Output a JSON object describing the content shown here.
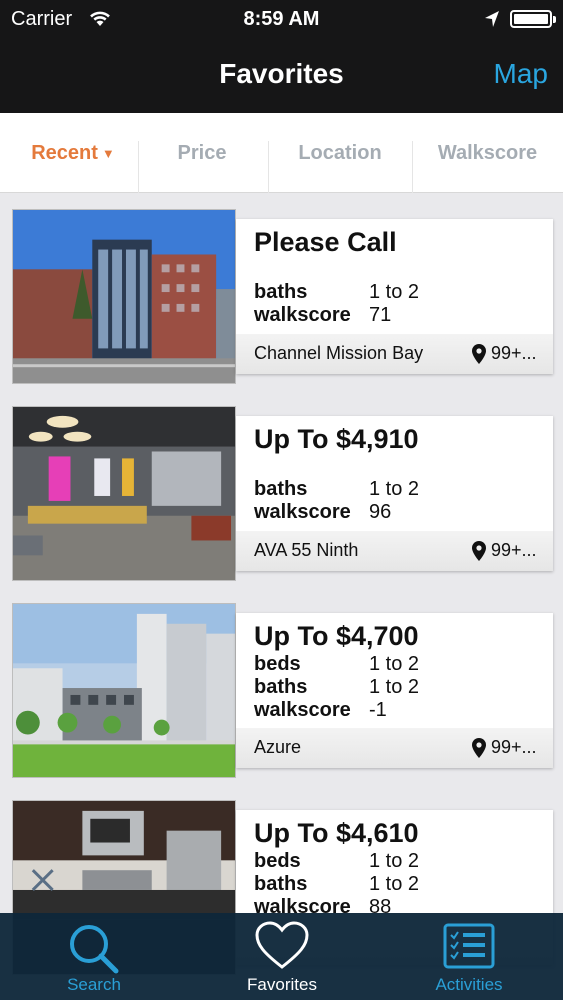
{
  "status_bar": {
    "carrier": "Carrier",
    "time": "8:59 AM"
  },
  "nav": {
    "title": "Favorites",
    "right_action": "Map"
  },
  "sort_tabs": [
    {
      "label": "Recent",
      "active": true
    },
    {
      "label": "Price",
      "active": false
    },
    {
      "label": "Location",
      "active": false
    },
    {
      "label": "Walkscore",
      "active": false
    }
  ],
  "listings": [
    {
      "price": "Please Call",
      "attrs": [
        {
          "k": "baths",
          "v": "1 to 2"
        },
        {
          "k": "walkscore",
          "v": "71"
        }
      ],
      "name": "Channel Mission Bay",
      "distance": "99+..."
    },
    {
      "price": "Up To $4,910",
      "attrs": [
        {
          "k": "baths",
          "v": "1 to 2"
        },
        {
          "k": "walkscore",
          "v": "96"
        }
      ],
      "name": "AVA 55 Ninth",
      "distance": "99+..."
    },
    {
      "price": "Up To $4,700",
      "attrs": [
        {
          "k": "beds",
          "v": "1 to 2"
        },
        {
          "k": "baths",
          "v": "1 to 2"
        },
        {
          "k": "walkscore",
          "v": "-1"
        }
      ],
      "name": "Azure",
      "distance": "99+..."
    },
    {
      "price": "Up To $4,610",
      "attrs": [
        {
          "k": "beds",
          "v": "1 to 2"
        },
        {
          "k": "baths",
          "v": "1 to 2"
        },
        {
          "k": "walkscore",
          "v": "88"
        }
      ],
      "name": "",
      "distance": ""
    }
  ],
  "tab_bar": [
    {
      "label": "Search",
      "icon": "search-icon"
    },
    {
      "label": "Favorites",
      "icon": "heart-icon"
    },
    {
      "label": "Activities",
      "icon": "checklist-icon"
    }
  ],
  "colors": {
    "accent_orange": "#e47a3c",
    "accent_blue": "#2aa6e0",
    "nav_bg": "#161617",
    "tabbar_bg": "#0f283a"
  }
}
